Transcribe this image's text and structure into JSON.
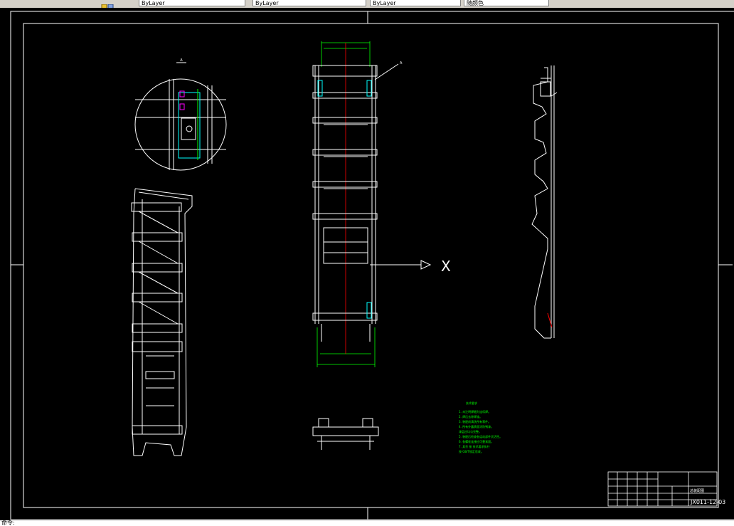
{
  "toolbar": {
    "layer_field_1": "ByLayer",
    "layer_field_2": "ByLayer",
    "layer_field_3": "ByLayer",
    "color_field": "随颜色"
  },
  "drawing": {
    "title_block": {
      "drawing_number": "JX011-12-03",
      "part_name": "总装配图"
    },
    "section_label": "X",
    "detail_label": "A",
    "tech_requirements": {
      "heading": "技术要求",
      "lines": [
        "1. 未注明焊缝为连续焊。",
        "2. 焊后去除焊渣。",
        "3. 装配前清洗所有零件。",
        "4. 所有外露表面涂防锈漆。",
        "   漆层应均匀完整。",
        "5. 装配后检查各运动部件灵活性。",
        "6. 各螺栓连接应可靠紧固。",
        "7. 其余  按  技术要求执行",
        "   按  GB/T规定验收。"
      ]
    }
  },
  "colors": {
    "drawing_line": "#ffffff",
    "dimension": "#00ff00",
    "center_line": "#ff0000",
    "hidden": "#00ffff",
    "highlight": "#ff00ff",
    "background": "#000000"
  },
  "command_line": "命令: "
}
